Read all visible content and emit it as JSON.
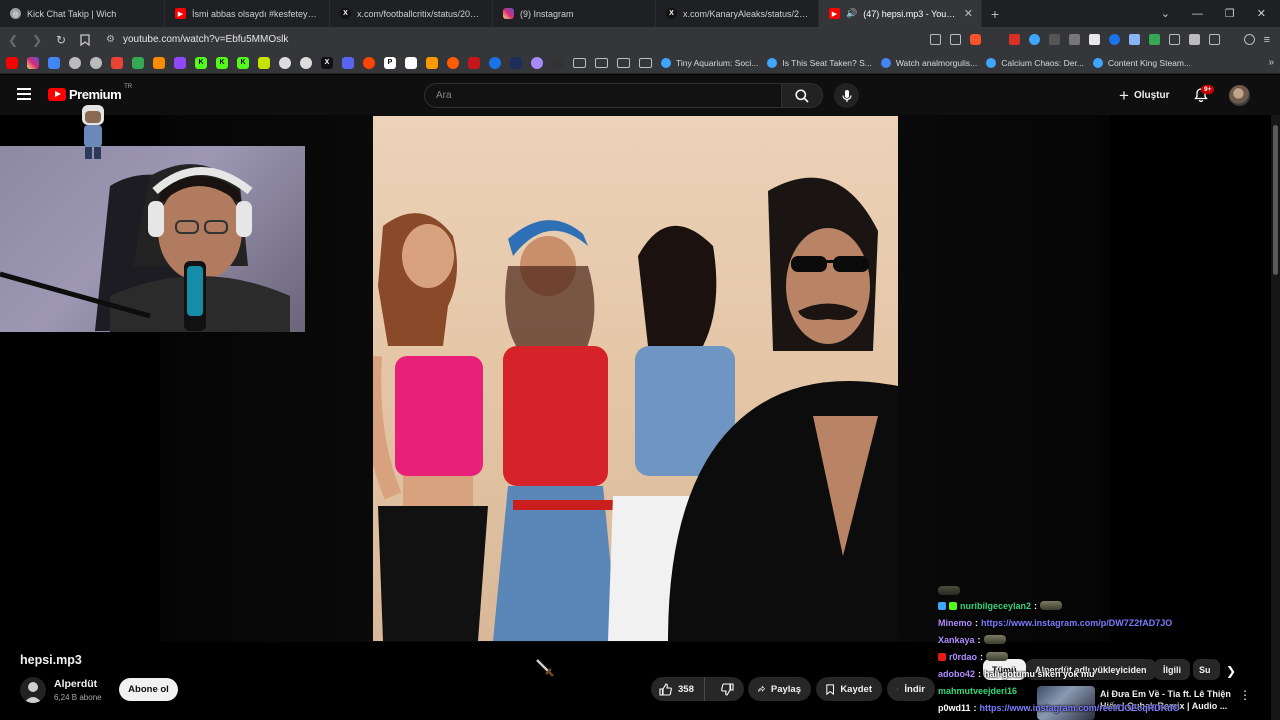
{
  "browser": {
    "tabs": [
      {
        "title": "Kick Chat Takip | Wich",
        "favicon_color": "#9aa0a6",
        "active": false
      },
      {
        "title": "İsmi abbas olsaydı #kesfeteyyiz #ytd",
        "favicon_color": "#ff0000",
        "active": false
      },
      {
        "title": "x.com/footballcritix/status/20433499",
        "favicon_color": "#000000",
        "active": false
      },
      {
        "title": "(9) Instagram",
        "favicon_color": "#d62976",
        "active": false
      },
      {
        "title": "x.com/KanaryAleaks/status/2042940",
        "favicon_color": "#000000",
        "active": false
      },
      {
        "title": "(47) hepsi.mp3 - YouTube",
        "favicon_color": "#ff0000",
        "active": true
      }
    ],
    "url": "youtube.com/watch?v=Ebfu5MMOslk",
    "bookmarks": [
      {
        "title": "Tiny Aquarium: Soci..."
      },
      {
        "title": "Is This Seat Taken? S..."
      },
      {
        "title": "Watch analmorgulis..."
      },
      {
        "title": "Calcium Chaos: Der..."
      },
      {
        "title": "Content King Steam..."
      }
    ]
  },
  "youtube": {
    "logo_text": "Premium",
    "logo_country": "TR",
    "search_placeholder": "Ara",
    "create_label": "Oluştur",
    "notification_count": "9+"
  },
  "video": {
    "title": "hepsi.mp3",
    "channel_name": "Alperdüt",
    "subscriber_count": "6,24 B abone",
    "subscribe_label": "Abone ol",
    "like_count": "358",
    "share_label": "Paylaş",
    "save_label": "Kaydet",
    "download_label": "İndir"
  },
  "chat": {
    "messages": [
      {
        "user": "nuribilgeceylan2",
        "user_color": "#37d67a",
        "message": "",
        "has_emote": true,
        "is_link": false
      },
      {
        "user": "Minemo",
        "user_color": "#b28cff",
        "message": "https://www.instagram.com/p/DW7Z2fAD7JO",
        "has_emote": false,
        "is_link": true
      },
      {
        "user": "Xankaya",
        "user_color": "#b28cff",
        "message": "",
        "has_emote": true,
        "is_link": false
      },
      {
        "user": "r0rdao",
        "user_color": "#b28cff",
        "message": "",
        "has_emote": true,
        "is_link": false
      },
      {
        "user": "adobo42",
        "user_color": "#b28cff",
        "message": "hali gotumu siken yok mu",
        "has_emote": false,
        "is_link": false
      },
      {
        "user": "mahmutveejderi16",
        "user_color": "#37d67a",
        "message": "",
        "has_emote": false,
        "is_link": false
      },
      {
        "user": "p0wd11",
        "user_color": "#ffffff",
        "message": "https://www.instagram.com/reel/DOEcqRDKdO",
        "has_emote": false,
        "is_link": true
      }
    ]
  },
  "sidebar": {
    "chips": [
      "Tümü",
      "Alperdüt adlı yükleyiciden",
      "İlgili",
      "Su"
    ],
    "recommendation": {
      "title": "Ai Đưa Em Về - Tia ft. Lê Thiện Hiếu | Qubak Remix | Audio ..."
    }
  }
}
